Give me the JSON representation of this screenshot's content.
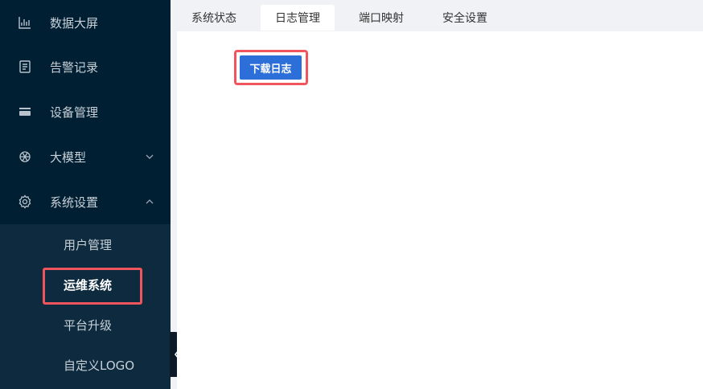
{
  "sidebar": {
    "items": [
      {
        "label": "数据大屏",
        "icon": "bar-chart-icon"
      },
      {
        "label": "告警记录",
        "icon": "document-list-icon"
      },
      {
        "label": "设备管理",
        "icon": "device-stack-icon"
      },
      {
        "label": "大模型",
        "icon": "model-knot-icon",
        "expand": "chevron-down-icon"
      },
      {
        "label": "系统设置",
        "icon": "gear-icon",
        "expand": "chevron-up-icon"
      }
    ],
    "submenu": [
      {
        "label": "用户管理"
      },
      {
        "label": "运维系统",
        "active": true
      },
      {
        "label": "平台升级"
      },
      {
        "label": "自定义LOGO"
      }
    ]
  },
  "tabs": [
    {
      "label": "系统状态"
    },
    {
      "label": "日志管理",
      "active": true
    },
    {
      "label": "端口映射"
    },
    {
      "label": "安全设置"
    }
  ],
  "main": {
    "download_button": "下载日志"
  },
  "colors": {
    "sidebar_bg": "#001f33",
    "submenu_bg": "#0d2a3e",
    "primary_button": "#2c6fd9",
    "highlight": "#f0545c"
  }
}
